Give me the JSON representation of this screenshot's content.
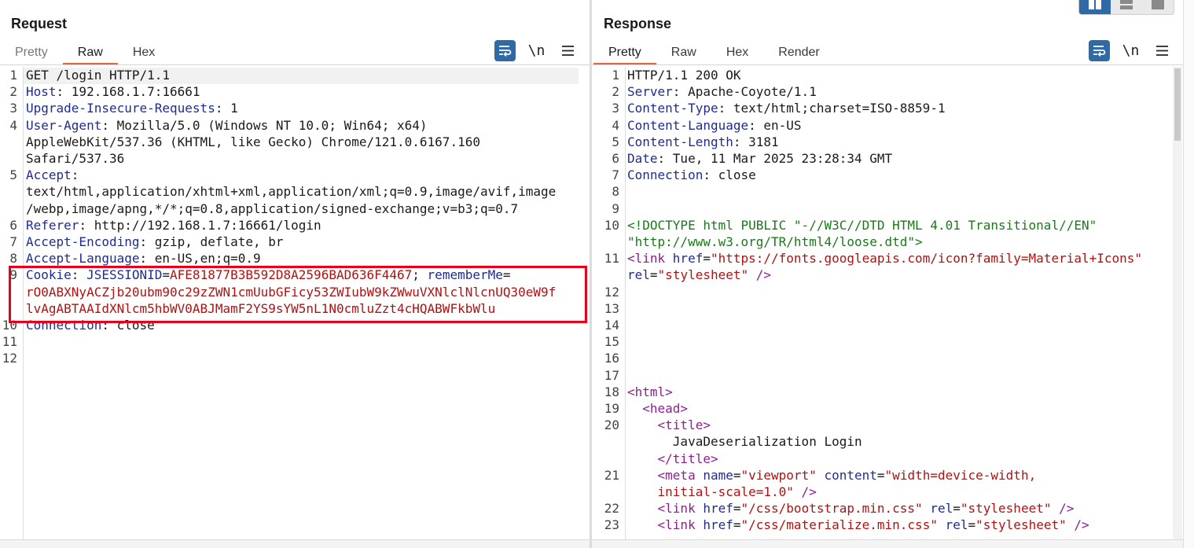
{
  "request": {
    "title": "Request",
    "tabs": [
      {
        "label": "Pretty",
        "state": "disabled"
      },
      {
        "label": "Raw",
        "state": "active"
      },
      {
        "label": "Hex",
        "state": "normal"
      }
    ],
    "newline_toggle": "\\n",
    "lines": [
      {
        "n": "1",
        "parts": [
          {
            "t": "GET /login HTTP/1.1",
            "c": "v"
          }
        ]
      },
      {
        "n": "2",
        "parts": [
          {
            "t": "Host",
            "c": "k"
          },
          {
            "t": ": 192.168.1.7:16661",
            "c": "v"
          }
        ]
      },
      {
        "n": "3",
        "parts": [
          {
            "t": "Upgrade-Insecure-Requests",
            "c": "k"
          },
          {
            "t": ": 1",
            "c": "v"
          }
        ]
      },
      {
        "n": "4",
        "parts": [
          {
            "t": "User-Agent",
            "c": "k"
          },
          {
            "t": ": Mozilla/5.0 (Windows NT 10.0; Win64; x64)",
            "c": "v"
          }
        ]
      },
      {
        "n": "",
        "parts": [
          {
            "t": "AppleWebKit/537.36 (KHTML, like Gecko) Chrome/121.0.6167.160",
            "c": "v"
          }
        ]
      },
      {
        "n": "",
        "parts": [
          {
            "t": "Safari/537.36",
            "c": "v"
          }
        ]
      },
      {
        "n": "5",
        "parts": [
          {
            "t": "Accept",
            "c": "k"
          },
          {
            "t": ":",
            "c": "v"
          }
        ]
      },
      {
        "n": "",
        "parts": [
          {
            "t": "text/html,application/xhtml+xml,application/xml;q=0.9,image/avif,image",
            "c": "v"
          }
        ]
      },
      {
        "n": "",
        "parts": [
          {
            "t": "/webp,image/apng,*/*;q=0.8,application/signed-exchange;v=b3;q=0.7",
            "c": "v"
          }
        ]
      },
      {
        "n": "6",
        "parts": [
          {
            "t": "Referer",
            "c": "k"
          },
          {
            "t": ": http://192.168.1.7:16661/login",
            "c": "v"
          }
        ]
      },
      {
        "n": "7",
        "parts": [
          {
            "t": "Accept-Encoding",
            "c": "k"
          },
          {
            "t": ": gzip, deflate, br",
            "c": "v"
          }
        ]
      },
      {
        "n": "8",
        "parts": [
          {
            "t": "Accept-Language",
            "c": "k"
          },
          {
            "t": ": en-US,en;q=0.9",
            "c": "v"
          }
        ]
      },
      {
        "n": "9",
        "parts": [
          {
            "t": "Cookie",
            "c": "k"
          },
          {
            "t": ": ",
            "c": "v"
          },
          {
            "t": "JSESSIONID",
            "c": "k"
          },
          {
            "t": "=",
            "c": "v"
          },
          {
            "t": "AFE81877B3B592D8A2596BAD636F4467",
            "c": "cv"
          },
          {
            "t": "; ",
            "c": "v"
          },
          {
            "t": "rememberMe",
            "c": "k"
          },
          {
            "t": "=",
            "c": "v"
          }
        ]
      },
      {
        "n": "",
        "parts": [
          {
            "t": "rO0ABXNyACZjb20ubm90c29zZWN1cmUubGFicy53ZWIubW9kZWwuVXNlclNlcnUQ30eW9f",
            "c": "cv"
          }
        ]
      },
      {
        "n": "",
        "parts": [
          {
            "t": "lvAgABTAAIdXNlcm5hbWV0ABJMamF2YS9sYW5nL1N0cmluZzt4cHQABWFkbWlu",
            "c": "cv"
          }
        ]
      },
      {
        "n": "10",
        "parts": [
          {
            "t": "Connection",
            "c": "k"
          },
          {
            "t": ": close",
            "c": "v"
          }
        ]
      },
      {
        "n": "11",
        "parts": []
      },
      {
        "n": "12",
        "parts": []
      }
    ]
  },
  "response": {
    "title": "Response",
    "tabs": [
      {
        "label": "Pretty",
        "state": "active"
      },
      {
        "label": "Raw",
        "state": "normal"
      },
      {
        "label": "Hex",
        "state": "normal"
      },
      {
        "label": "Render",
        "state": "normal"
      }
    ],
    "newline_toggle": "\\n",
    "lines": [
      {
        "n": "1",
        "parts": [
          {
            "t": "HTTP/1.1 200 OK",
            "c": "v"
          }
        ]
      },
      {
        "n": "2",
        "parts": [
          {
            "t": "Server",
            "c": "k"
          },
          {
            "t": ": Apache-Coyote/1.1",
            "c": "v"
          }
        ]
      },
      {
        "n": "3",
        "parts": [
          {
            "t": "Content-Type",
            "c": "k"
          },
          {
            "t": ": text/html;charset=ISO-8859-1",
            "c": "v"
          }
        ]
      },
      {
        "n": "4",
        "parts": [
          {
            "t": "Content-Language",
            "c": "k"
          },
          {
            "t": ": en-US",
            "c": "v"
          }
        ]
      },
      {
        "n": "5",
        "parts": [
          {
            "t": "Content-Length",
            "c": "k"
          },
          {
            "t": ": 3181",
            "c": "v"
          }
        ]
      },
      {
        "n": "6",
        "parts": [
          {
            "t": "Date",
            "c": "k"
          },
          {
            "t": ": Tue, 11 Mar 2025 23:28:34 GMT",
            "c": "v"
          }
        ]
      },
      {
        "n": "7",
        "parts": [
          {
            "t": "Connection",
            "c": "k"
          },
          {
            "t": ": close",
            "c": "v"
          }
        ]
      },
      {
        "n": "8",
        "parts": []
      },
      {
        "n": "9",
        "parts": []
      },
      {
        "n": "10",
        "parts": [
          {
            "t": "<!DOCTYPE html PUBLIC \"-//W3C//DTD HTML 4.01 Transitional//EN\"",
            "c": "doc"
          }
        ]
      },
      {
        "n": "",
        "parts": [
          {
            "t": "\"http://www.w3.org/TR/html4/loose.dtd\">",
            "c": "doc"
          }
        ]
      },
      {
        "n": "11",
        "parts": [
          {
            "t": "<link ",
            "c": "tag"
          },
          {
            "t": "href",
            "c": "attr"
          },
          {
            "t": "=",
            "c": "v"
          },
          {
            "t": "\"https://fonts.googleapis.com/icon?family=Material+Icons\"",
            "c": "str"
          }
        ]
      },
      {
        "n": "",
        "parts": [
          {
            "t": "rel",
            "c": "attr"
          },
          {
            "t": "=",
            "c": "v"
          },
          {
            "t": "\"stylesheet\"",
            "c": "str"
          },
          {
            "t": " />",
            "c": "tag"
          }
        ]
      },
      {
        "n": "12",
        "parts": []
      },
      {
        "n": "13",
        "parts": []
      },
      {
        "n": "14",
        "parts": []
      },
      {
        "n": "15",
        "parts": []
      },
      {
        "n": "16",
        "parts": []
      },
      {
        "n": "17",
        "parts": []
      },
      {
        "n": "18",
        "parts": [
          {
            "t": "<html>",
            "c": "tag"
          }
        ]
      },
      {
        "n": "19",
        "parts": [
          {
            "t": "  ",
            "c": "v"
          },
          {
            "t": "<head>",
            "c": "tag"
          }
        ]
      },
      {
        "n": "20",
        "parts": [
          {
            "t": "    ",
            "c": "v"
          },
          {
            "t": "<title>",
            "c": "tag"
          }
        ]
      },
      {
        "n": "",
        "parts": [
          {
            "t": "      JavaDeserialization Login",
            "c": "v"
          }
        ]
      },
      {
        "n": "",
        "parts": [
          {
            "t": "    ",
            "c": "v"
          },
          {
            "t": "</title>",
            "c": "tag"
          }
        ]
      },
      {
        "n": "21",
        "parts": [
          {
            "t": "    ",
            "c": "v"
          },
          {
            "t": "<meta ",
            "c": "tag"
          },
          {
            "t": "name",
            "c": "attr"
          },
          {
            "t": "=",
            "c": "v"
          },
          {
            "t": "\"viewport\"",
            "c": "str"
          },
          {
            "t": " ",
            "c": "v"
          },
          {
            "t": "content",
            "c": "attr"
          },
          {
            "t": "=",
            "c": "v"
          },
          {
            "t": "\"width=device-width,",
            "c": "str"
          }
        ]
      },
      {
        "n": "",
        "parts": [
          {
            "t": "    ",
            "c": "v"
          },
          {
            "t": "initial-scale=1.0\"",
            "c": "str"
          },
          {
            "t": " />",
            "c": "tag"
          }
        ]
      },
      {
        "n": "22",
        "parts": [
          {
            "t": "    ",
            "c": "v"
          },
          {
            "t": "<link ",
            "c": "tag"
          },
          {
            "t": "href",
            "c": "attr"
          },
          {
            "t": "=",
            "c": "v"
          },
          {
            "t": "\"/css/bootstrap.min.css\"",
            "c": "str"
          },
          {
            "t": " ",
            "c": "v"
          },
          {
            "t": "rel",
            "c": "attr"
          },
          {
            "t": "=",
            "c": "v"
          },
          {
            "t": "\"stylesheet\"",
            "c": "str"
          },
          {
            "t": " />",
            "c": "tag"
          }
        ]
      },
      {
        "n": "23",
        "parts": [
          {
            "t": "    ",
            "c": "v"
          },
          {
            "t": "<link ",
            "c": "tag"
          },
          {
            "t": "href",
            "c": "attr"
          },
          {
            "t": "=",
            "c": "v"
          },
          {
            "t": "\"/css/materialize.min.css\"",
            "c": "str"
          },
          {
            "t": " ",
            "c": "v"
          },
          {
            "t": "rel",
            "c": "attr"
          },
          {
            "t": "=",
            "c": "v"
          },
          {
            "t": "\"stylesheet\"",
            "c": "str"
          },
          {
            "t": " />",
            "c": "tag"
          }
        ]
      }
    ]
  },
  "colors": {
    "accent_tab": "#e8643c",
    "highlight_box": "#e8001b",
    "header_key": "#1f2d8f",
    "cookie_value": "#b01212",
    "html_tag": "#8e1f8e",
    "doctype": "#1a7a1a",
    "toolbar_button": "#2f6aa6"
  },
  "icons": {
    "wrap": "wrap-lines-icon",
    "menu": "hamburger-menu-icon",
    "layout": [
      "split-horizontal-icon",
      "split-vertical-icon",
      "single-pane-icon"
    ]
  }
}
